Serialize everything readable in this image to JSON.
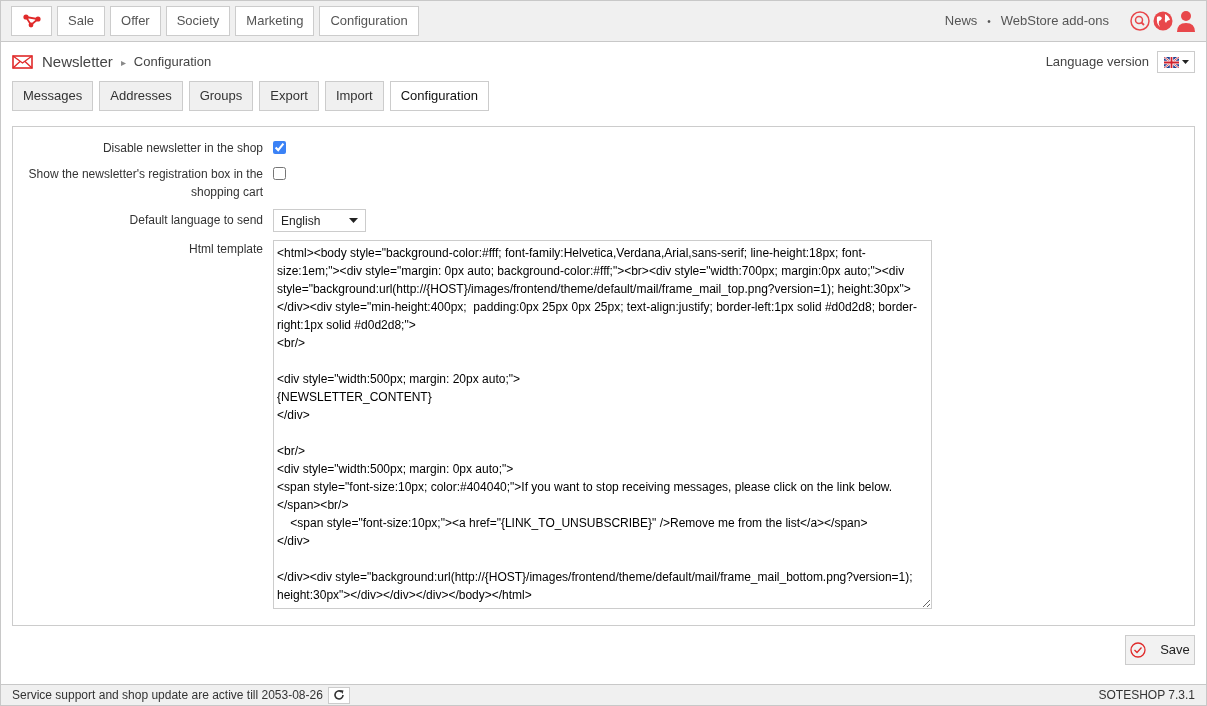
{
  "top_nav": {
    "items": [
      {
        "label": "Sale"
      },
      {
        "label": "Offer"
      },
      {
        "label": "Society"
      },
      {
        "label": "Marketing"
      },
      {
        "label": "Configuration"
      }
    ],
    "links": [
      "News",
      "•",
      "WebStore add-ons"
    ]
  },
  "breadcrumb": {
    "module": "Newsletter",
    "separator": "▸",
    "page": "Configuration"
  },
  "language_version": {
    "label": "Language version"
  },
  "tabs": [
    {
      "label": "Messages",
      "selected": false
    },
    {
      "label": "Addresses",
      "selected": false
    },
    {
      "label": "Groups",
      "selected": false
    },
    {
      "label": "Export",
      "selected": false
    },
    {
      "label": "Import",
      "selected": false
    },
    {
      "label": "Configuration",
      "selected": true
    }
  ],
  "form": [
    {
      "kind": "checkbox",
      "label": "Disable newsletter in the shop",
      "checked": true
    },
    {
      "kind": "checkbox",
      "label": "Show the newsletter's registration box in the shopping cart",
      "checked": false
    },
    {
      "kind": "select",
      "label": "Default language to send",
      "value": "English"
    },
    {
      "kind": "textarea",
      "label": "Html template",
      "value": "<html><body style=\"background-color:#fff; font-family:Helvetica,Verdana,Arial,sans-serif; line-height:18px; font-size:1em;\"><div style=\"margin: 0px auto; background-color:#fff;\"><br><div style=\"width:700px; margin:0px auto;\"><div style=\"background:url(http://{HOST}/images/frontend/theme/default/mail/frame_mail_top.png?version=1); height:30px\"></div><div style=\"min-height:400px;  padding:0px 25px 0px 25px; text-align:justify; border-left:1px solid #d0d2d8; border-right:1px solid #d0d2d8;\">\n<br/>\n\n<div style=\"width:500px; margin: 20px auto;\">\n{NEWSLETTER_CONTENT}\n</div>\n\n<br/>\n<div style=\"width:500px; margin: 0px auto;\">\n<span style=\"font-size:10px; color:#404040;\">If you want to stop receiving messages, please click on the link below.\n</span><br/>\n    <span style=\"font-size:10px;\"><a href=\"{LINK_TO_UNSUBSCRIBE}\" />Remove me from the list</a></span>\n</div>\n\n</div><div style=\"background:url(http://{HOST}/images/frontend/theme/default/mail/frame_mail_bottom.png?version=1); height:30px\"></div></div></div></body></html>"
    }
  ],
  "save_button": "Save",
  "status_bar": {
    "message": "Service support and shop update are active till 2053-08-26",
    "version": "SOTESHOP 7.3.1"
  }
}
